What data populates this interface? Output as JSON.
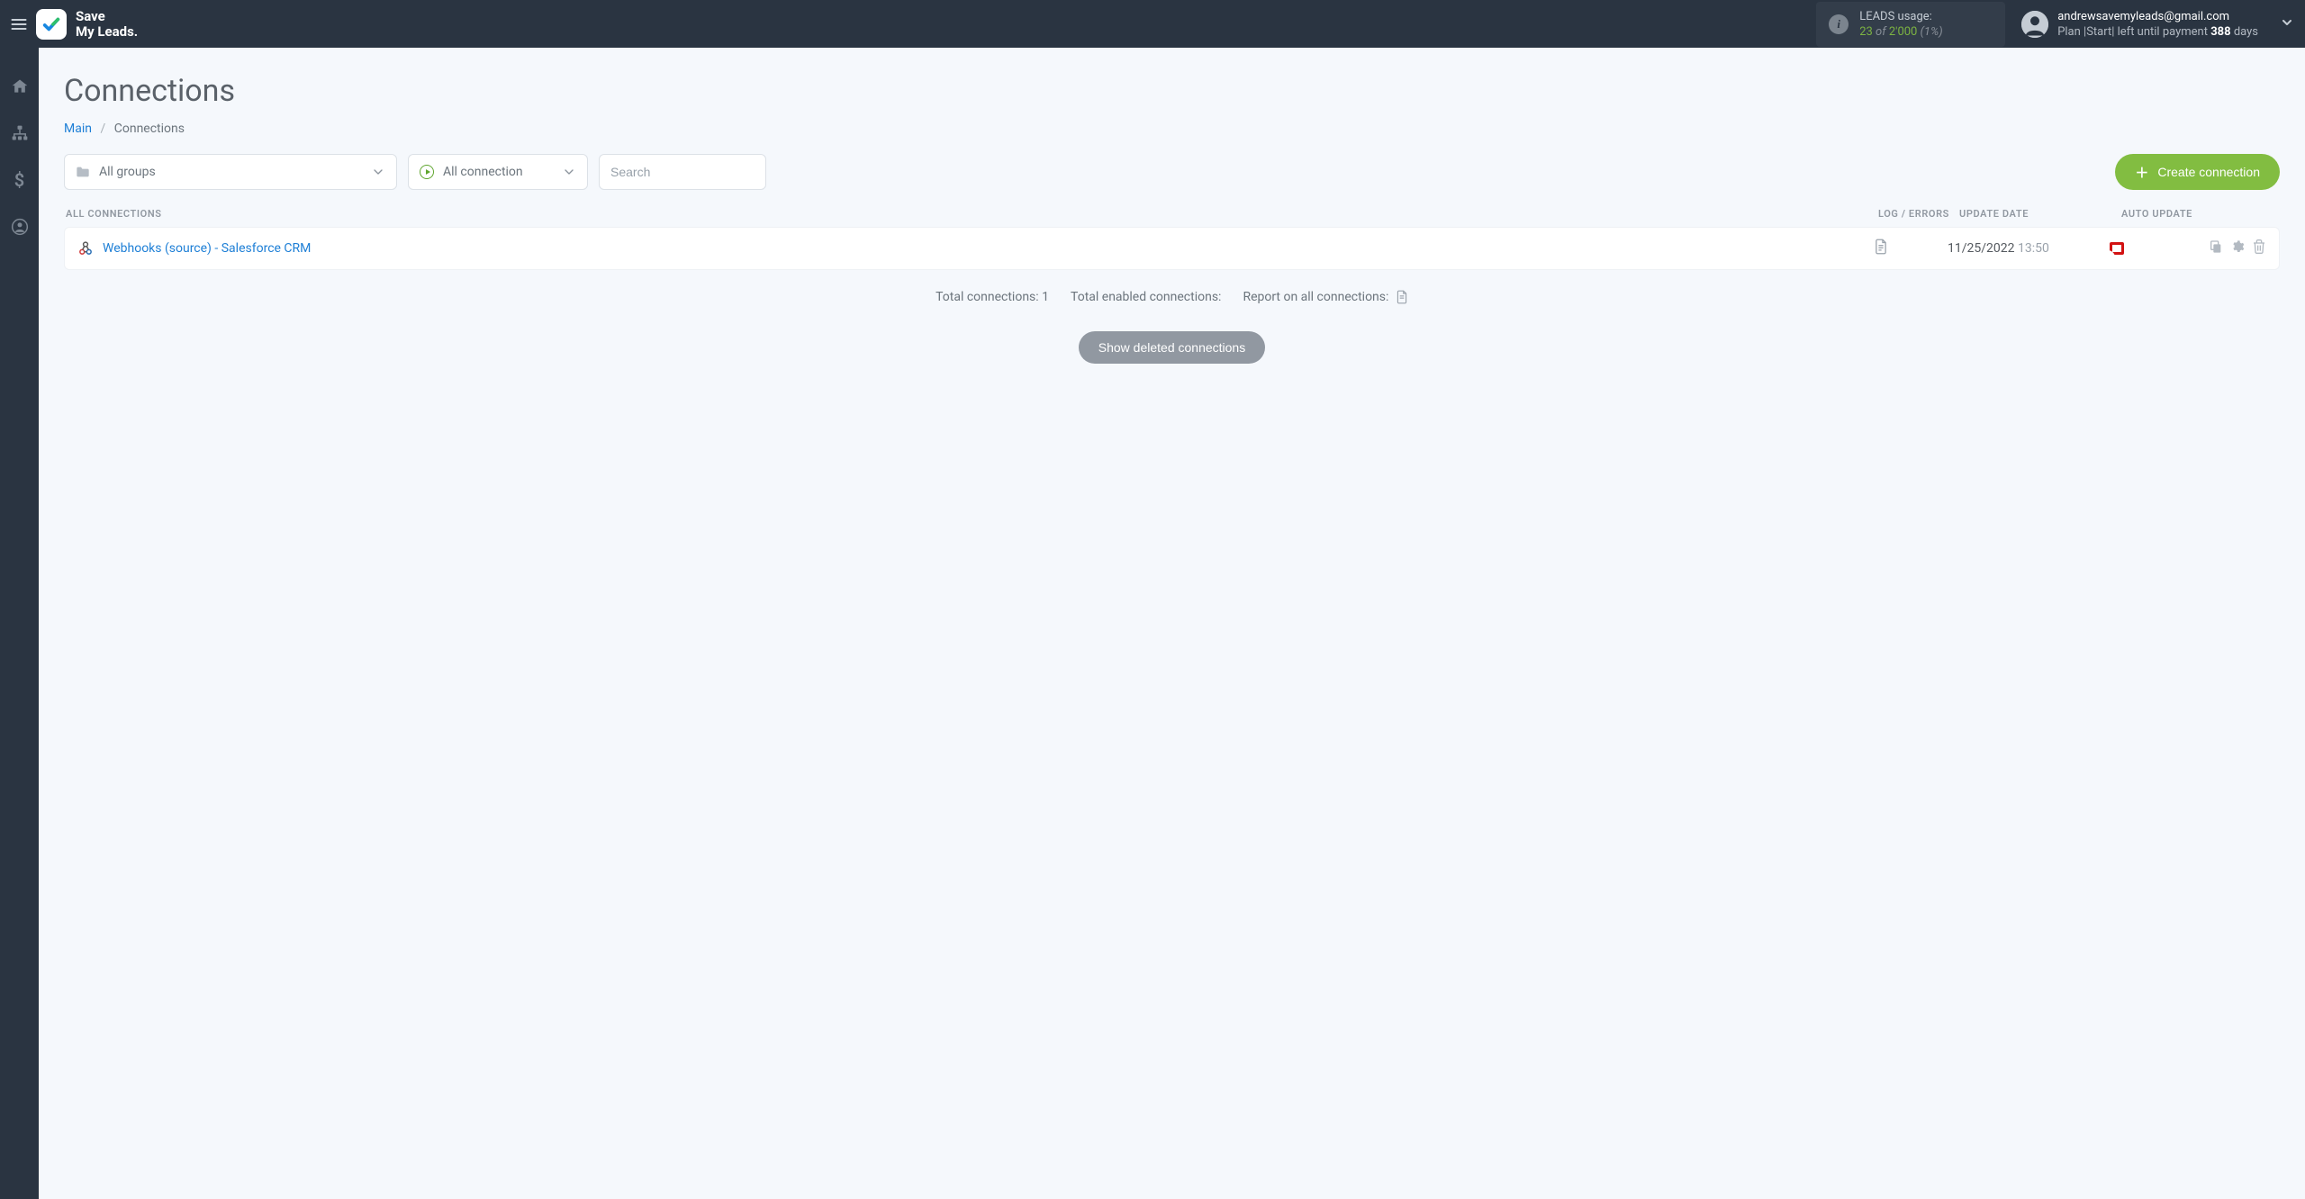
{
  "brand": {
    "line1": "Save",
    "line2": "My Leads."
  },
  "usage": {
    "label": "LEADS usage:",
    "used": "23",
    "of": "of",
    "total": "2'000",
    "pct": "(1%)"
  },
  "user": {
    "email": "andrewsavemyleads@gmail.com",
    "plan_prefix": "Plan |Start| left until payment ",
    "days": "388",
    "days_suffix": " days"
  },
  "page": {
    "title": "Connections",
    "breadcrumb": {
      "main": "Main",
      "current": "Connections"
    }
  },
  "filters": {
    "groups_label": "All groups",
    "status_label": "All connection",
    "search_placeholder": "Search"
  },
  "buttons": {
    "create": "Create connection",
    "show_deleted": "Show deleted connections"
  },
  "columns": {
    "all": "ALL CONNECTIONS",
    "log": "LOG / ERRORS",
    "date": "UPDATE DATE",
    "auto": "AUTO UPDATE"
  },
  "rows": [
    {
      "name": "Webhooks (source) - Salesforce CRM",
      "date": "11/25/2022",
      "time": "13:50",
      "auto": true
    }
  ],
  "summary": {
    "total_label": "Total connections: ",
    "total_value": "1",
    "enabled_label": "Total enabled connections:",
    "report_label": "Report on all connections:"
  }
}
